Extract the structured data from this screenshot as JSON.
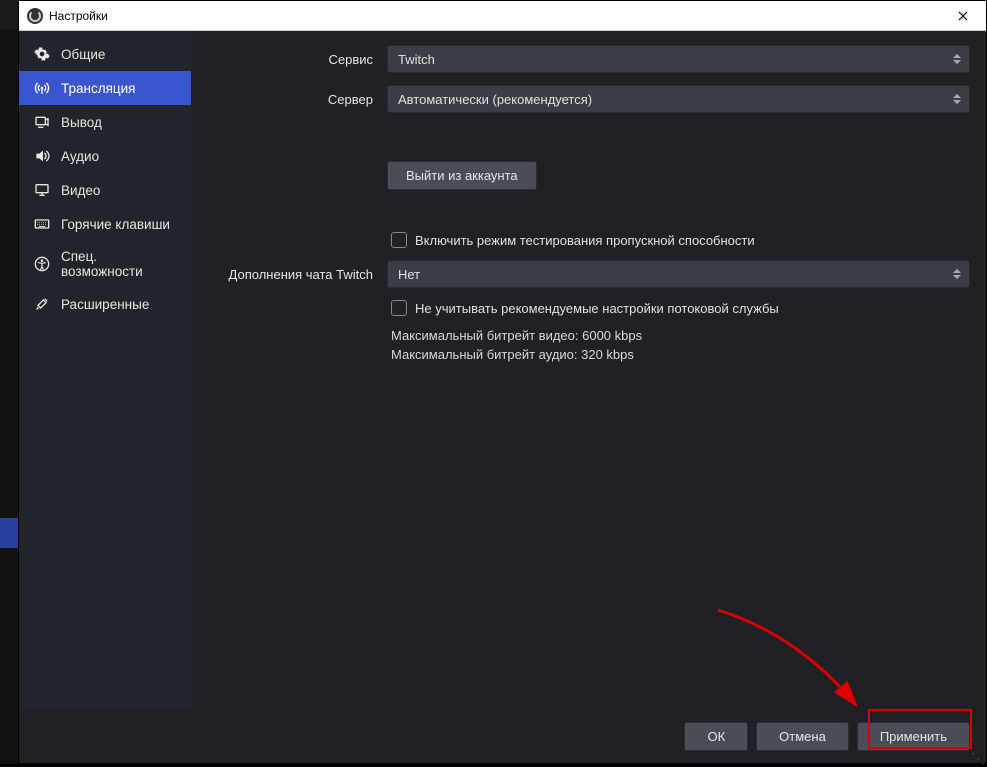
{
  "window": {
    "title": "Настройки"
  },
  "sidebar": {
    "items": [
      {
        "label": "Общие"
      },
      {
        "label": "Трансляция"
      },
      {
        "label": "Вывод"
      },
      {
        "label": "Аудио"
      },
      {
        "label": "Видео"
      },
      {
        "label": "Горячие клавиши"
      },
      {
        "label": "Спец. возможности"
      },
      {
        "label": "Расширенные"
      }
    ]
  },
  "form": {
    "service_label": "Сервис",
    "service_value": "Twitch",
    "server_label": "Сервер",
    "server_value": "Автоматически (рекомендуется)",
    "logout_btn": "Выйти из аккаунта",
    "bandwidth_test": "Включить режим тестирования пропускной способности",
    "twitch_addons_label": "Дополнения чата Twitch",
    "twitch_addons_value": "Нет",
    "ignore_rec": "Не учитывать рекомендуемые настройки потоковой службы",
    "max_video": "Максимальный битрейт видео: 6000 kbps",
    "max_audio": "Максимальный битрейт аудио: 320 kbps"
  },
  "footer": {
    "ok": "ОК",
    "cancel": "Отмена",
    "apply": "Применить"
  }
}
